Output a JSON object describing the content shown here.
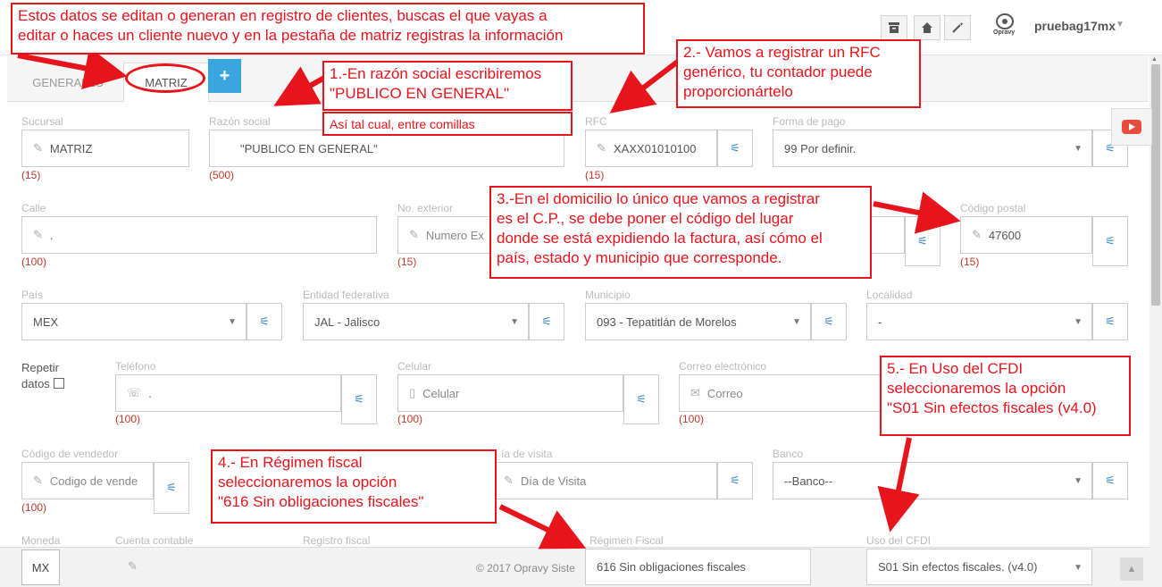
{
  "topbar": {
    "user": "pruebag17mx",
    "logo": "Opravy",
    "icons": [
      "archive-icon",
      "home-icon",
      "magic-wand-icon"
    ]
  },
  "tabs": [
    {
      "label": "GENERALES"
    },
    {
      "label": "MATRIZ"
    },
    {
      "label": "+"
    }
  ],
  "form": {
    "sucursal": {
      "label": "Sucursal",
      "value": "MATRIZ",
      "count": "(15)"
    },
    "razon": {
      "label": "Razón social",
      "value": "\"PUBLICO EN GENERAL\"",
      "count": "(500)"
    },
    "rfc": {
      "label": "RFC",
      "value": "XAXX01010100",
      "count": "(15)"
    },
    "forma_pago": {
      "label": "Forma de pago",
      "value": "99 Por definir."
    },
    "calle": {
      "label": "Calle",
      "value": ".",
      "count": "(100)"
    },
    "no_exterior": {
      "label": "No. exterior",
      "placeholder": "Numero Ex",
      "count": "(15)"
    },
    "codigo_postal": {
      "label": "Código postal",
      "value": "47600",
      "count": "(15)"
    },
    "pais": {
      "label": "País",
      "value": "MEX"
    },
    "entidad": {
      "label": "Entidad federativa",
      "value": "JAL - Jalisco"
    },
    "municipio": {
      "label": "Municipio",
      "value": "093 - Tepatitlán de Morelos"
    },
    "localidad": {
      "label": "Localidad",
      "value": "-"
    },
    "repetir": {
      "line1": "Repetir",
      "line2": "datos"
    },
    "telefono": {
      "label": "Teléfono",
      "value": ".",
      "count": "(100)"
    },
    "celular": {
      "label": "Celular",
      "placeholder": "Celular",
      "count": "(100)"
    },
    "correo": {
      "label": "Correo electrónico",
      "placeholder": "Correo",
      "count": "(100)"
    },
    "vendedor": {
      "label": "Código de vendedor",
      "placeholder": "Codigo de vende",
      "count": "(100)"
    },
    "dia_visita": {
      "label": "ía de visita",
      "placeholder": "Día de Visita"
    },
    "banco": {
      "label": "Banco",
      "value": "--Banco--"
    },
    "moneda": {
      "label": "Moneda",
      "value": "MX"
    },
    "cuenta": {
      "label": "Cuenta contable"
    },
    "registro": {
      "label": "Registro fiscal"
    },
    "regimen": {
      "label": "Régimen Fiscal",
      "value": "616 Sin obligaciones fiscales"
    },
    "uso_cfdi": {
      "label": "Uso del CFDI",
      "value": "S01 Sin efectos fiscales. (v4.0)"
    }
  },
  "footer": {
    "copyright": "© 2017 Opravy Siste"
  },
  "annotations": {
    "top": {
      "line1": "Estos datos se editan o generan en registro de clientes, buscas el que vayas a",
      "line2": "editar o haces un cliente nuevo y en la pestaña de matriz registras la  información"
    },
    "n1": {
      "line1": "1.-En razón social escribiremos",
      "line2": "\"PUBLICO EN GENERAL\""
    },
    "n1b": "Así tal cual, entre comillas",
    "n2": {
      "line1": "2.- Vamos a registrar un RFC",
      "line2": "genérico, tu contador puede",
      "line3": "proporcionártelo"
    },
    "n3": {
      "line1": "3.-En el domicilio lo único que vamos a registrar",
      "line2": "es el C.P., se debe poner el código del lugar",
      "line3": "donde se está expidiendo la factura, así cómo el",
      "line4": "país, estado y municipio que corresponde."
    },
    "n4": {
      "line1": "4.- En Régimen fiscal",
      "line2": "seleccionaremos la opción",
      "line3": "\"616 Sin obligaciones fiscales\""
    },
    "n5": {
      "line1": "5.- En Uso del CFDI",
      "line2": "seleccionaremos la opción",
      "line3": "\"S01 Sin efectos fiscales (v4.0)"
    }
  }
}
